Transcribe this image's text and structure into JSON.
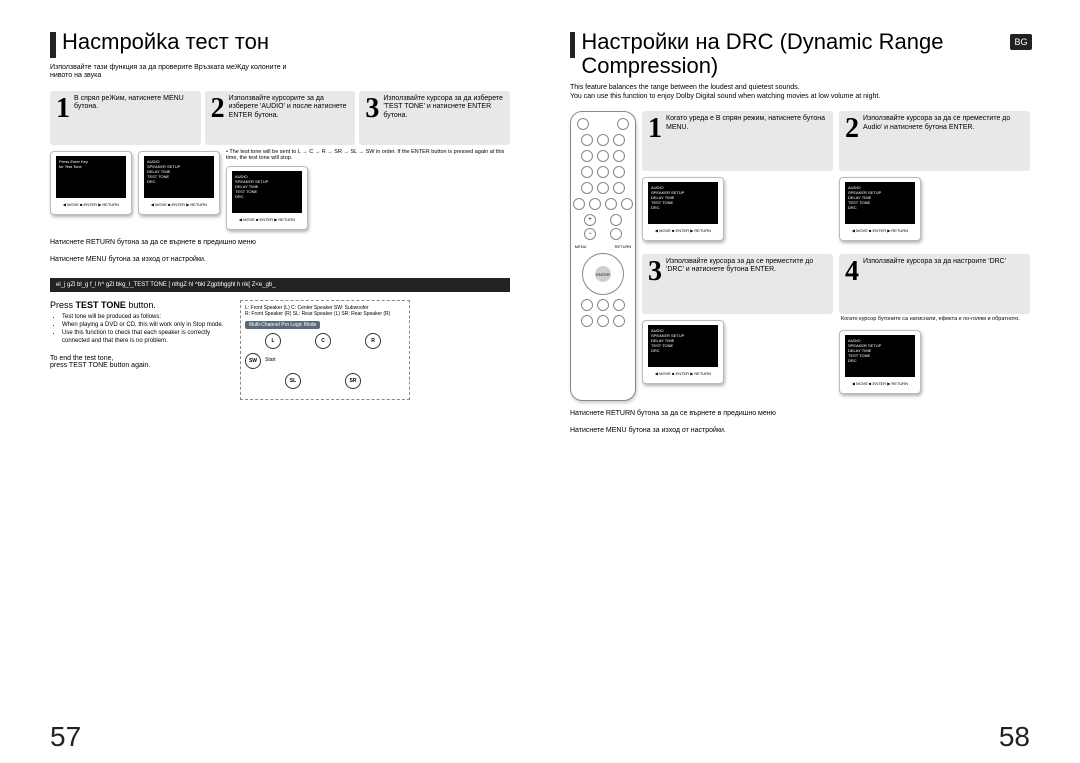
{
  "left": {
    "title": "Насmройka тест тон",
    "intro": "Използвайте тази функция за да проверите Връзката меЖду колоните и\nнивото на звука",
    "steps": [
      {
        "num": "1",
        "text": "В спрял реЖим, натиснете MENU бутона."
      },
      {
        "num": "2",
        "text": "Използвайте курсорите за да изберете 'AUDIO' и после натиснете ENTER бутона."
      },
      {
        "num": "3",
        "text": "Използвайте курсора за да изберете 'TEST TONE' и натиснете ENTER бутона."
      }
    ],
    "step3_note": "• The test tone will be sent to L → C → R → SR → SL → SW in order. If the ENTER button is pressed again at this time, the test tone will stop.",
    "return1": "Натиснете RETURN бутона за да се върнете в предишно меню",
    "return2": "Натиснете   MENU бутона за изход от настройки.",
    "blackbar": "el_j gZl bl_g f_l h^ gZl bkg_l_TEST TONE [ nlhgZ hl ^bkl Zgpbhgghl h nk[ Z<e_gb_",
    "press_main": "Press TEST TONE button.",
    "press_bullets": [
      "Test tone will be produced as follows:",
      "When playing a DVD or CD, this will work only in Stop mode.",
      "Use this function to check that each speaker is correctly connected and that there is no problem."
    ],
    "end1": "To end the test tone,",
    "end2": "press TEST TONE button again.",
    "legend": "L: Front Speaker (L)   C: Center Speaker   SW: Subwoofer\nR: Front Speaker (R)   SL: Rear Speaker (L)   SR: Rear Speaker (R)",
    "mcmode": "Multi-Channel Pro Logic Mode",
    "spk": {
      "L": "L",
      "C": "C",
      "R": "R",
      "SW": "SW",
      "SL": "SL",
      "SR": "SR",
      "start": "Start"
    },
    "pagenum": "57"
  },
  "right": {
    "title": "Настройки на DRC (Dynamic Range Compression)",
    "bg": "BG",
    "intro": "This feature balances the range between the loudest and quietest sounds.\nYou can use this function to enjoy Dolby Digital sound when watching movies at low volume at night.",
    "steps": [
      {
        "num": "1",
        "text": "Когато уреда е В спрян режим, натиснете бутона MENU."
      },
      {
        "num": "2",
        "text": "Използвайте курсора за да се преместите до Audio' и натиснете бутона ENTER."
      },
      {
        "num": "3",
        "text": "Използвайте курсора за да се преместите до 'DRC' и натиснете бутона ENTER."
      },
      {
        "num": "4",
        "text": "Използвайте курсора за да настроите 'DRC'"
      }
    ],
    "rnote": "Когато курсор бутоните са натиснати, ефекта е по-голям и обратното.",
    "return1": "Натиснете RETURN бутона за да се върнете в предишно меню",
    "return2": "Натиснете   MENU бутона за изход от настройки.",
    "pagenum": "58"
  },
  "screens": {
    "audio_menu": "AUDIO\nSPEAKER SETUP\nDELAY TIME\nTEST TONE\nDRC",
    "footer": "◀ MOVE   ■ ENTER   ▶ RETURN",
    "ptg": "Press Enter Key\nfor Test Tone"
  }
}
